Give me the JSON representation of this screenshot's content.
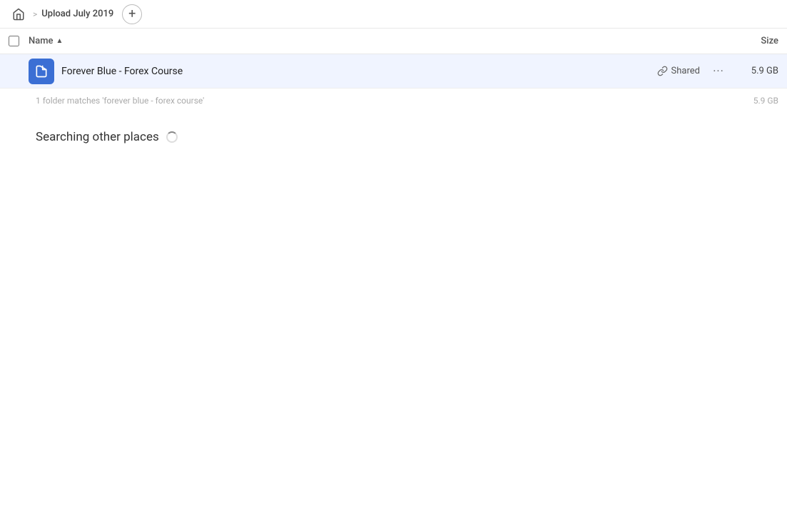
{
  "breadcrumb": {
    "home_label": "Home",
    "separator": ">",
    "current_path": "Upload July 2019",
    "add_button_label": "+"
  },
  "columns": {
    "name_label": "Name",
    "sort_direction": "▲",
    "size_label": "Size"
  },
  "file_row": {
    "name": "Forever Blue - Forex Course",
    "shared_label": "Shared",
    "more_label": "···",
    "size": "5.9 GB",
    "icon_label": "shared-folder-icon"
  },
  "folder_matches": {
    "text": "1 folder matches 'forever blue - forex course'",
    "size": "5.9 GB"
  },
  "searching": {
    "text": "Searching other places"
  }
}
